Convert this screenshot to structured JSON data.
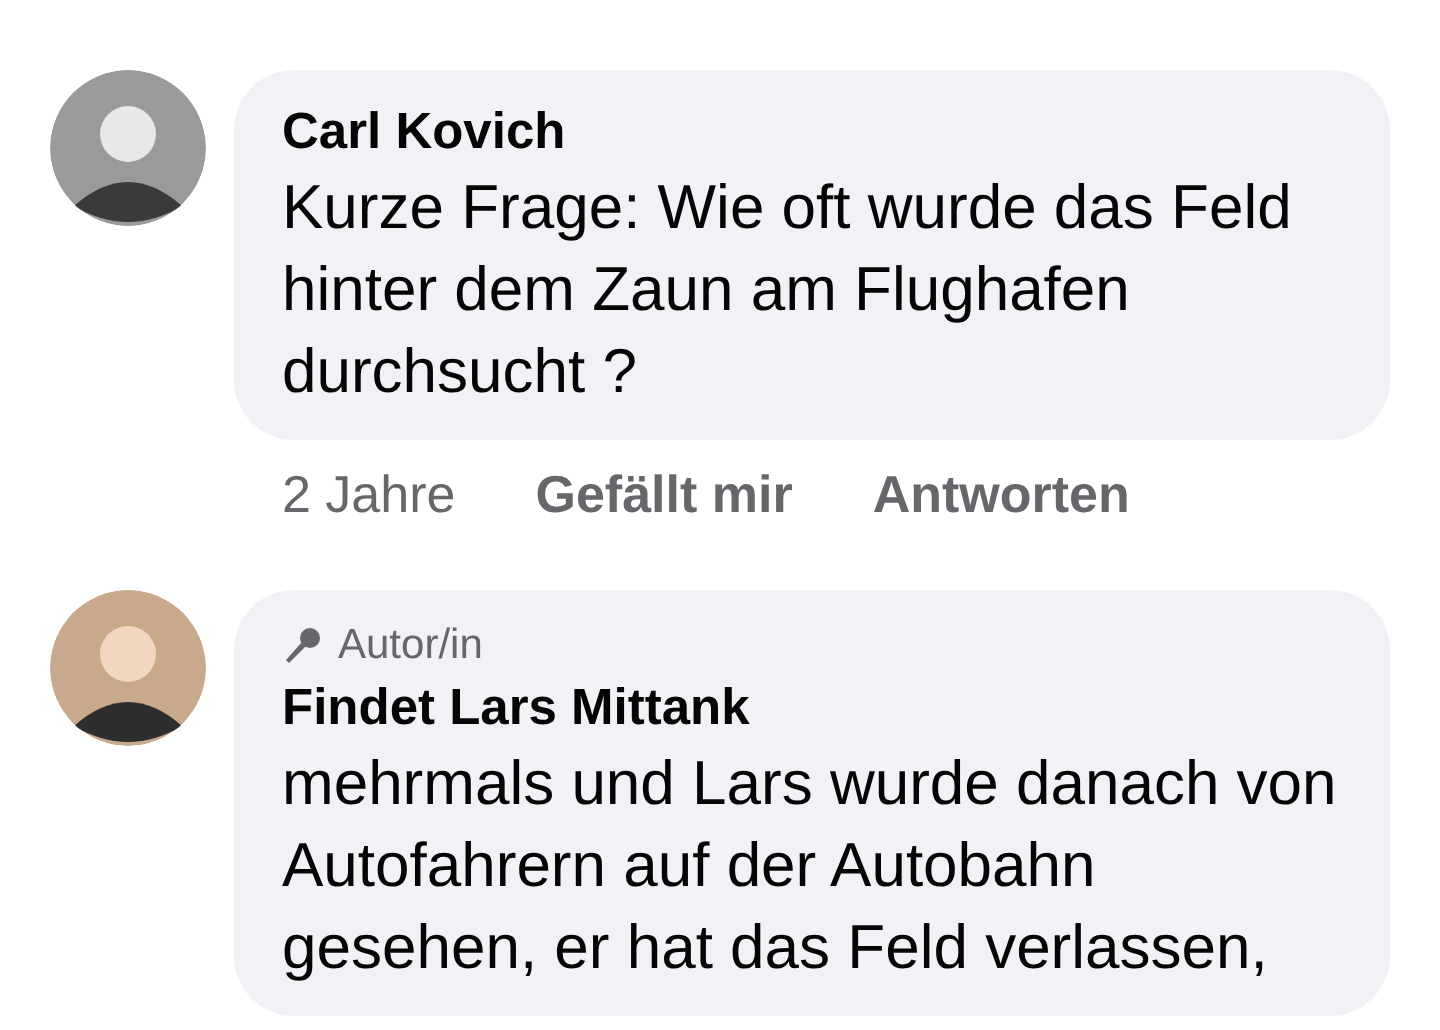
{
  "comments": [
    {
      "author": "Carl Kovich",
      "text": "Kurze Frage: Wie oft wurde das Feld hinter dem Zaun am Flughafen durchsucht ?",
      "actions": [
        "2 Jahre",
        "Gefällt mir",
        "Antworten"
      ]
    },
    {
      "author": "Findet Lars Mittank",
      "badge": "Autor/in",
      "text": "mehrmals und Lars wurde danach von Autofahrern auf der Autobahn gesehen, er hat das Feld verlassen,"
    }
  ]
}
